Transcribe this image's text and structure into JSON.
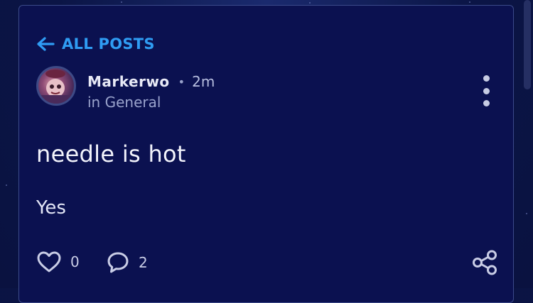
{
  "nav": {
    "back_label": "ALL POSTS",
    "back_icon": "arrow-left-icon"
  },
  "post": {
    "author": "Markerwo",
    "separator": "•",
    "time": "2m",
    "category": "in General",
    "title": "needle is hot",
    "body": "Yes",
    "likes": "0",
    "comments": "2"
  },
  "colors": {
    "accent": "#2f9cf3",
    "card_bg": "#0b1150",
    "page_bg": "#0a1240"
  }
}
